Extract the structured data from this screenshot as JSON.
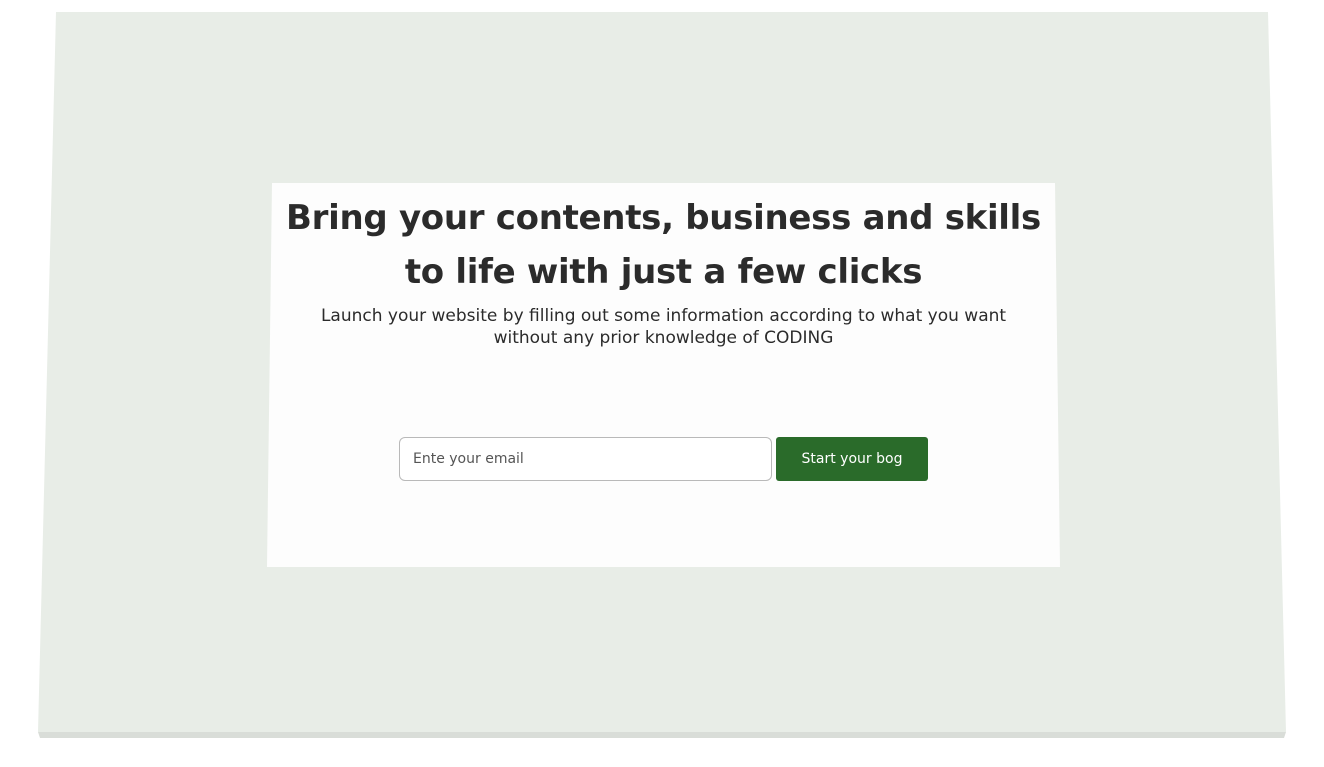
{
  "hero": {
    "headline": "Bring your contents, business and skills to life with just a few clicks",
    "subtext": "Launch your website by filling out some information according to what you want without any prior knowledge of CODING"
  },
  "signup": {
    "email_placeholder": "Ente your email",
    "email_value": "",
    "button_label": "Start your bog"
  },
  "colors": {
    "background": "#e8ede7",
    "card": "#fdfdfd",
    "text": "#2b2b2b",
    "button": "#2a6b2a"
  }
}
